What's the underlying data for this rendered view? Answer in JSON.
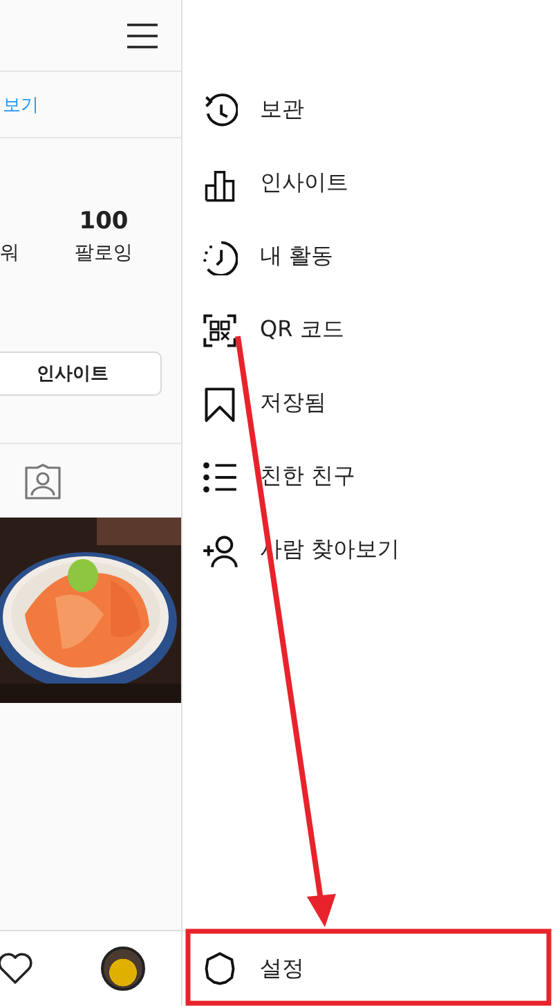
{
  "profile": {
    "link": "보기",
    "stats": [
      {
        "label": "워"
      },
      {
        "value": "100",
        "label": "팔로잉"
      }
    ],
    "insights_button": "인사이트"
  },
  "menu": {
    "items": [
      {
        "kind": "archive",
        "label": "보관"
      },
      {
        "kind": "insights",
        "label": "인사이트"
      },
      {
        "kind": "activity",
        "label": "내 활동"
      },
      {
        "kind": "qr",
        "label": "QR 코드"
      },
      {
        "kind": "saved",
        "label": "저장됨"
      },
      {
        "kind": "friends",
        "label": "친한 친구"
      },
      {
        "kind": "discover",
        "label": "사람 찾아보기"
      }
    ],
    "settings": {
      "kind": "settings",
      "label": "설정"
    }
  },
  "annotations": {
    "arrow": true,
    "highlight_box": true
  }
}
